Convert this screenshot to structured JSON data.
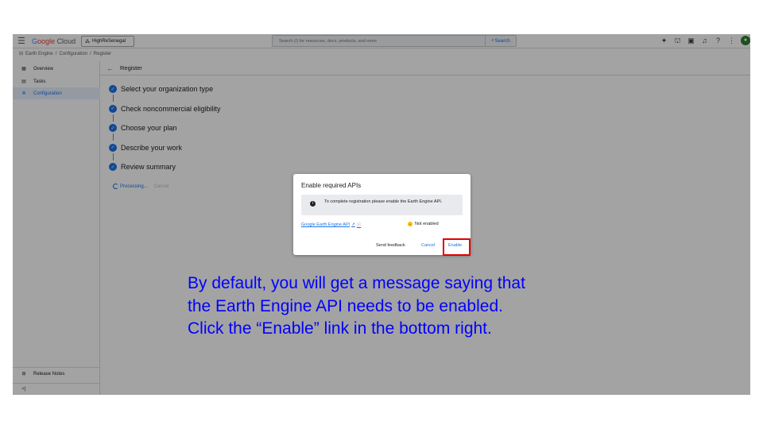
{
  "topbar": {
    "brand_g": "G",
    "brand_rest": "oogle",
    "brand_cloud": "Cloud",
    "project_name": "HighReSenegal",
    "search_placeholder": "Search (/) for resources, docs, products, and more",
    "search_button": "Search",
    "icons": [
      "gemini-icon",
      "gift-icon",
      "terminal-icon",
      "bell-icon",
      "help-icon",
      "more-vert-icon",
      "avatar"
    ]
  },
  "breadcrumb": {
    "items": [
      "Earth Engine",
      "Configuration",
      "Register"
    ],
    "separator": "/"
  },
  "sidebar": {
    "items": [
      {
        "label": "Overview",
        "icon": "dashboard-icon"
      },
      {
        "label": "Tasks",
        "icon": "tasks-icon"
      },
      {
        "label": "Configuration",
        "icon": "gear-icon",
        "active": true
      }
    ],
    "bottom": {
      "label": "Release Notes",
      "icon": "release-notes-icon"
    },
    "collapse": "<|"
  },
  "main": {
    "title": "Register",
    "steps": [
      "Select your organization type",
      "Check noncommercial eligibility",
      "Choose your plan",
      "Describe your work",
      "Review summary"
    ],
    "processing_label": "Processing...",
    "cancel_label": "Cancel"
  },
  "dialog": {
    "title": "Enable required APIs",
    "info_text": "To complete registration please enable the Earth Engine API.",
    "api_name": "Google Earth Engine API",
    "status": "Not enabled",
    "feedback_label": "Send feedback",
    "cancel_label": "Cancel",
    "enable_label": "Enable"
  },
  "caption": {
    "line1": "By default, you will get a message saying that",
    "line2": "the Earth Engine API needs to be enabled.",
    "line3": "Click the “Enable” link in the bottom right."
  },
  "colors": {
    "accent": "#1a73e8",
    "highlight_box": "#e00000",
    "caption_text": "#0000ff",
    "status_warning": "#fbbc04"
  }
}
